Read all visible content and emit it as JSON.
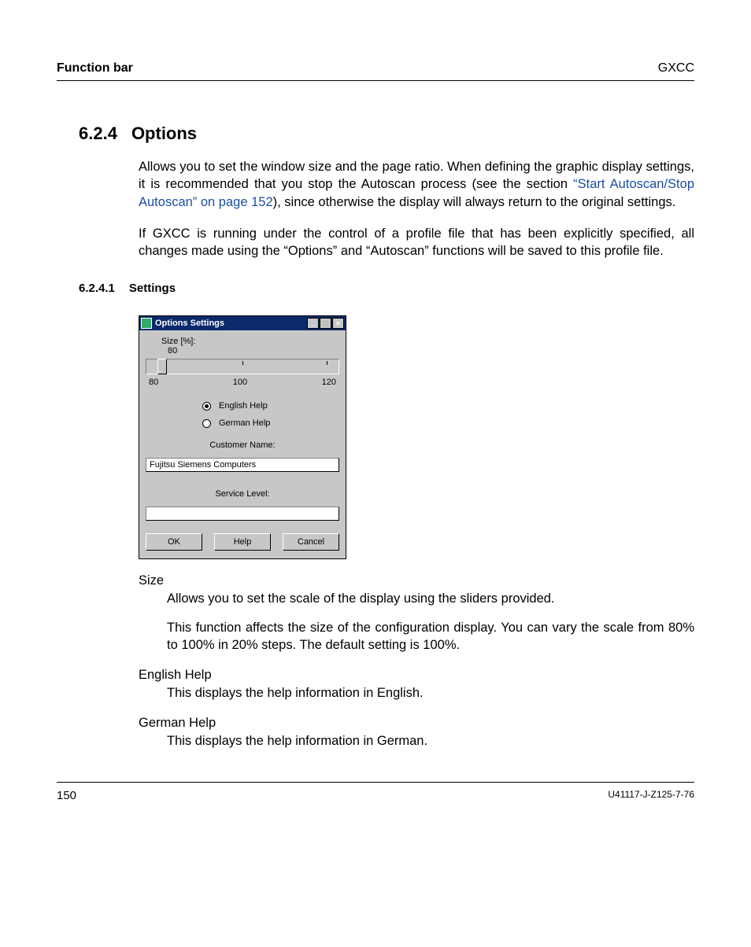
{
  "header": {
    "left": "Function bar",
    "right": "GXCC"
  },
  "section": {
    "num": "6.2.4",
    "title": "Options"
  },
  "para1_a": "Allows you to set the window size and the page ratio. When defining the graphic display settings, it is recommended that you stop the Autoscan process (see the section ",
  "para1_link": "“Start Autoscan/Stop Autoscan” on page 152",
  "para1_b": "), since otherwise the display will always return to the original settings.",
  "para2": "If GXCC is running under the control of a profile file that has been explicitly specified, all changes made using the “Options” and “Autoscan” functions will be saved to this profile file.",
  "sub": {
    "num": "6.2.4.1",
    "title": "Settings"
  },
  "dialog": {
    "title": "Options Settings",
    "size_label": "Size [%]:",
    "size_value": "80",
    "scale": {
      "min": "80",
      "mid": "100",
      "max": "120"
    },
    "radio1": "English Help",
    "radio2": "German Help",
    "cust_label": "Customer Name:",
    "cust_value": "Fujitsu Siemens Computers",
    "svc_label": "Service Level:",
    "svc_value": "",
    "ok": "OK",
    "help": "Help",
    "cancel": "Cancel"
  },
  "defs": {
    "size_t": "Size",
    "size_b1": "Allows you to set the scale of the display using the sliders provided.",
    "size_b2": "This function affects the size of the configuration display. You can vary the scale from 80% to 100% in 20% steps. The default setting is 100%.",
    "eng_t": "English Help",
    "eng_b": "This displays the help information in English.",
    "ger_t": "German Help",
    "ger_b": "This displays the help information in German."
  },
  "footer": {
    "page": "150",
    "docid": "U41117-J-Z125-7-76"
  }
}
